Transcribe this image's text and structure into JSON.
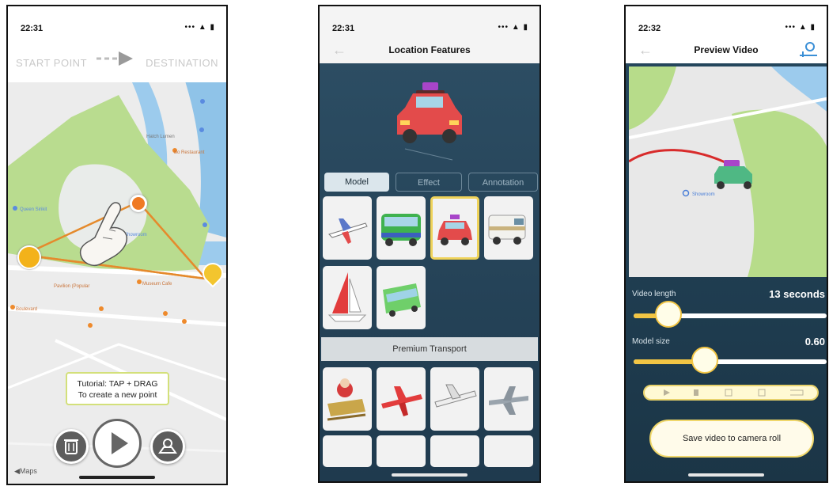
{
  "screen1": {
    "time": "22:31",
    "signal": "••• ▲ ▮",
    "start_label": "START POINT",
    "destination_label": "DESTINATION",
    "tutorial_line1": "Tutorial: TAP + DRAG",
    "tutorial_line2": "To create a new point",
    "maps_logo": "◀Maps"
  },
  "screen2": {
    "time": "22:31",
    "signal": "••• ▲ ▮",
    "title": "Location Features",
    "tabs": [
      {
        "label": "Model"
      },
      {
        "label": "Effect"
      },
      {
        "label": "Annotation"
      }
    ],
    "premium_label": "Premium Transport"
  },
  "screen3": {
    "time": "22:32",
    "signal": "••• ▲ ▮",
    "title": "Preview Video",
    "video_length_label": "Video length",
    "video_length_value": "13 seconds",
    "model_size_label": "Model size",
    "model_size_value": "0.60",
    "save_label": "Save video to camera roll",
    "video_length_fraction": 0.18,
    "model_size_fraction": 0.37
  },
  "colors": {
    "route_orange": "#e58a2c",
    "pin_orange": "#ee8a2c",
    "accent_yellow": "#f2c544",
    "park_green": "#b9dc8f",
    "water_blue": "#8fc3e8",
    "panel_navy": "#24465c"
  }
}
